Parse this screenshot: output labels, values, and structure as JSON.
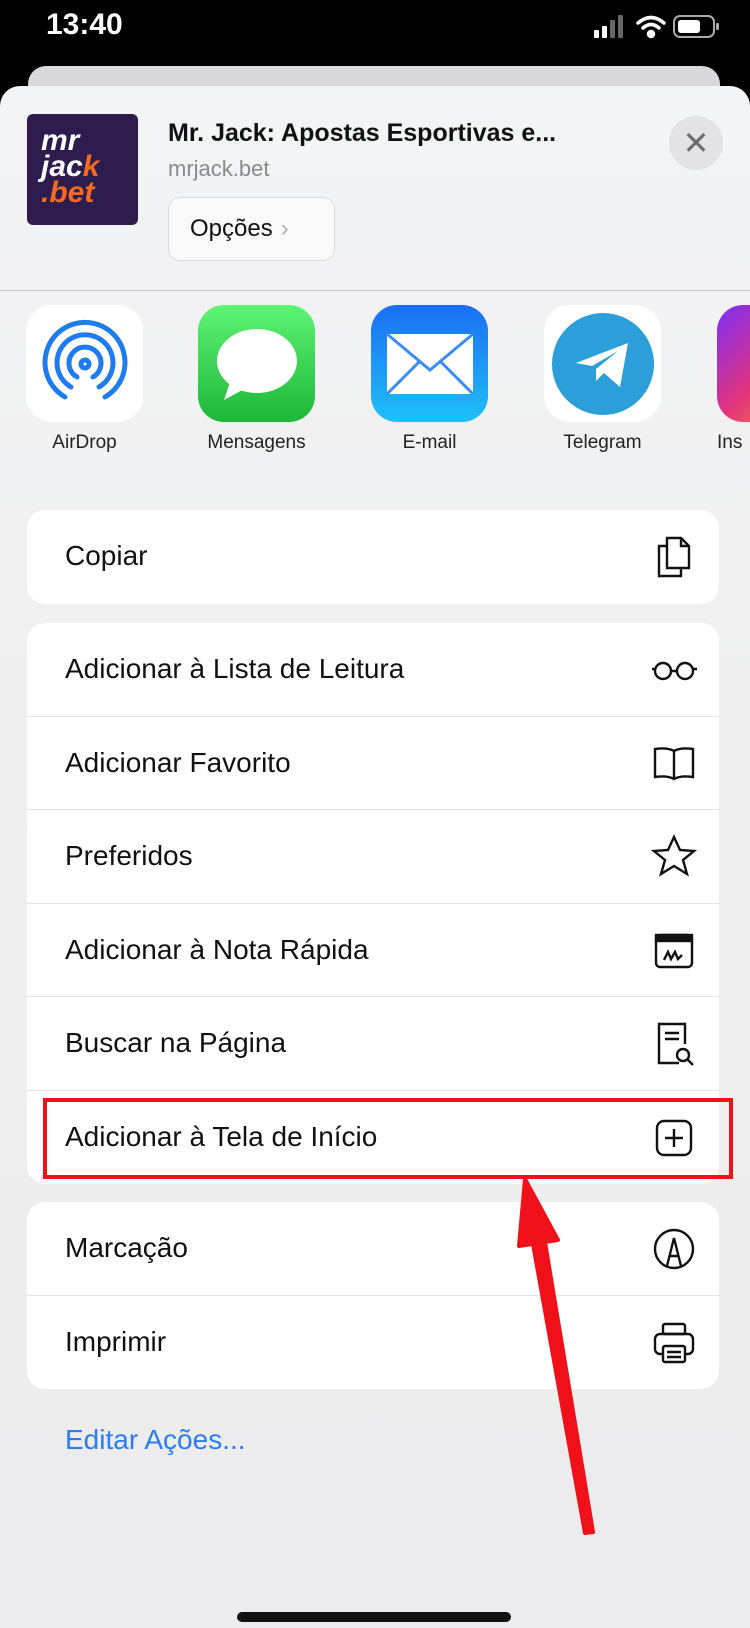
{
  "status_bar": {
    "time": "13:40",
    "icons": [
      "signal-icon",
      "wifi-icon",
      "battery-icon"
    ]
  },
  "header": {
    "logo_text": [
      "mr",
      "jack",
      ".bet"
    ],
    "title": "Mr. Jack: Apostas Esportivas e...",
    "url": "mrjack.bet",
    "options_label": "Opções",
    "close": "close-icon"
  },
  "apps": [
    {
      "label": "AirDrop"
    },
    {
      "label": "Mensagens"
    },
    {
      "label": "E-mail"
    },
    {
      "label": "Telegram"
    },
    {
      "label": "Ins"
    }
  ],
  "groups": [
    [
      {
        "label": "Copiar",
        "icon": "copy-icon"
      }
    ],
    [
      {
        "label": "Adicionar à Lista de Leitura",
        "icon": "glasses-icon"
      },
      {
        "label": "Adicionar Favorito",
        "icon": "book-icon"
      },
      {
        "label": "Preferidos",
        "icon": "star-icon"
      },
      {
        "label": "Adicionar à Nota Rápida",
        "icon": "quick-note-icon"
      },
      {
        "label": "Buscar na Página",
        "icon": "find-in-page-icon"
      },
      {
        "label": "Adicionar à Tela de Início",
        "icon": "add-square-icon"
      }
    ],
    [
      {
        "label": "Marcação",
        "icon": "markup-icon"
      },
      {
        "label": "Imprimir",
        "icon": "printer-icon"
      }
    ]
  ],
  "edit_actions": "Editar Ações...",
  "annotation": {
    "highlight_color": "#f0101a"
  }
}
